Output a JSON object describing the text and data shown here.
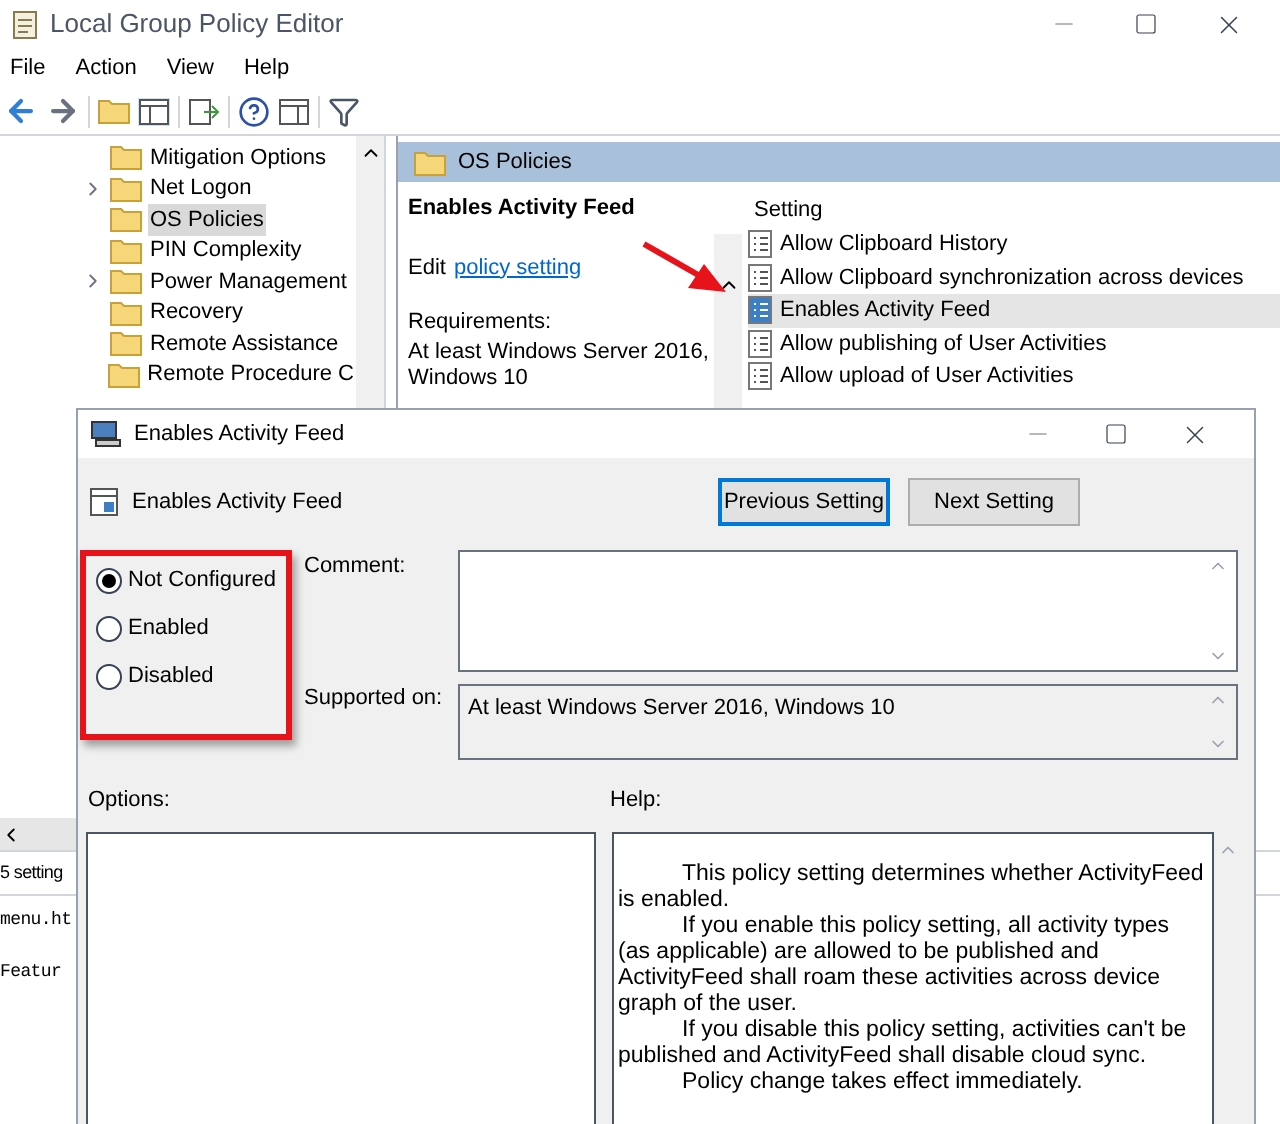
{
  "window": {
    "title": "Local Group Policy Editor"
  },
  "menu": [
    "File",
    "Action",
    "View",
    "Help"
  ],
  "tree": {
    "items": [
      {
        "label": "Mitigation Options",
        "expandable": false,
        "selected": false
      },
      {
        "label": "Net Logon",
        "expandable": true,
        "selected": false
      },
      {
        "label": "OS Policies",
        "expandable": false,
        "selected": true
      },
      {
        "label": "PIN Complexity",
        "expandable": false,
        "selected": false
      },
      {
        "label": "Power Management",
        "expandable": true,
        "selected": false
      },
      {
        "label": "Recovery",
        "expandable": false,
        "selected": false
      },
      {
        "label": "Remote Assistance",
        "expandable": false,
        "selected": false
      },
      {
        "label": "Remote Procedure C",
        "expandable": false,
        "selected": false
      }
    ]
  },
  "right_pane": {
    "header": "OS Policies",
    "policy_title": "Enables Activity Feed",
    "edit_prefix": "Edit",
    "edit_link": "policy setting",
    "requirements_label": "Requirements:",
    "requirements": "At least Windows Server 2016, Windows 10"
  },
  "settings": {
    "header": "Setting",
    "items": [
      {
        "label": "Allow Clipboard History",
        "selected": false
      },
      {
        "label": "Allow Clipboard synchronization across devices",
        "selected": false
      },
      {
        "label": "Enables Activity Feed",
        "selected": true
      },
      {
        "label": "Allow publishing of User Activities",
        "selected": false
      },
      {
        "label": "Allow upload of User Activities",
        "selected": false
      }
    ]
  },
  "status_bar": "5 setting",
  "background_lines": [
    "menu.ht",
    "Featur"
  ],
  "dialog": {
    "title": "Enables Activity Feed",
    "policy_name": "Enables Activity Feed",
    "buttons": [
      {
        "label": "Previous Setting",
        "focused": true
      },
      {
        "label": "Next Setting",
        "focused": false
      }
    ],
    "options": [
      {
        "label": "Not Configured",
        "selected": true
      },
      {
        "label": "Enabled",
        "selected": false
      },
      {
        "label": "Disabled",
        "selected": false
      }
    ],
    "comment_label": "Comment:",
    "supported_label": "Supported on:",
    "supported": "At least Windows Server 2016, Windows 10",
    "options_label": "Options:",
    "help_label": "Help:",
    "help": [
      "This policy setting determines whether ActivityFeed is enabled.",
      "If you enable this policy setting, all activity types (as applicable) are allowed to be published and ActivityFeed shall roam these activities across device graph of the user.",
      "If you disable this policy setting, activities can't be published and ActivityFeed shall disable cloud sync.",
      "Policy change takes effect immediately."
    ]
  }
}
